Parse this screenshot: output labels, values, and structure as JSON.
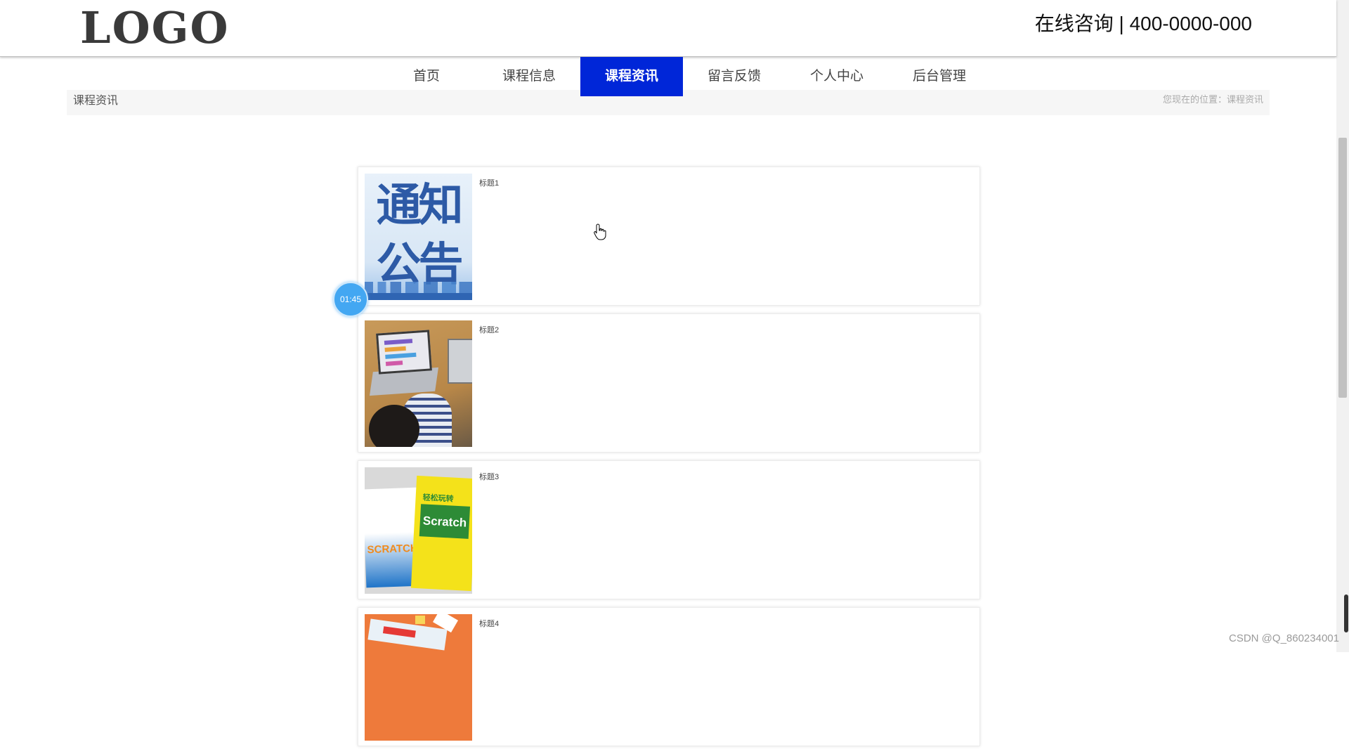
{
  "header": {
    "logo": "LOGO",
    "hotline": "在线咨询 | 400-0000-000"
  },
  "nav": {
    "items": [
      {
        "label": "首页",
        "active": false
      },
      {
        "label": "课程信息",
        "active": false
      },
      {
        "label": "课程资讯",
        "active": true
      },
      {
        "label": "留言反馈",
        "active": false
      },
      {
        "label": "个人中心",
        "active": false
      },
      {
        "label": "后台管理",
        "active": false
      }
    ]
  },
  "breadcrumb": {
    "title": "课程资讯",
    "path": "您现在的位置：课程资讯"
  },
  "news": [
    {
      "title": "标题1",
      "thumb_text_top": "通知",
      "thumb_text_bottom": "公告"
    },
    {
      "title": "标题2"
    },
    {
      "title": "标题3",
      "thumb_book1_text": "SCRATCH",
      "thumb_book2_text": "Scratch",
      "thumb_book2_top": "轻松玩转"
    },
    {
      "title": "标题4"
    }
  ],
  "timer": "01:45",
  "watermark": "CSDN @Q_860234001",
  "colors": {
    "nav_active": "#0026d8",
    "timer": "#43a7f2"
  }
}
